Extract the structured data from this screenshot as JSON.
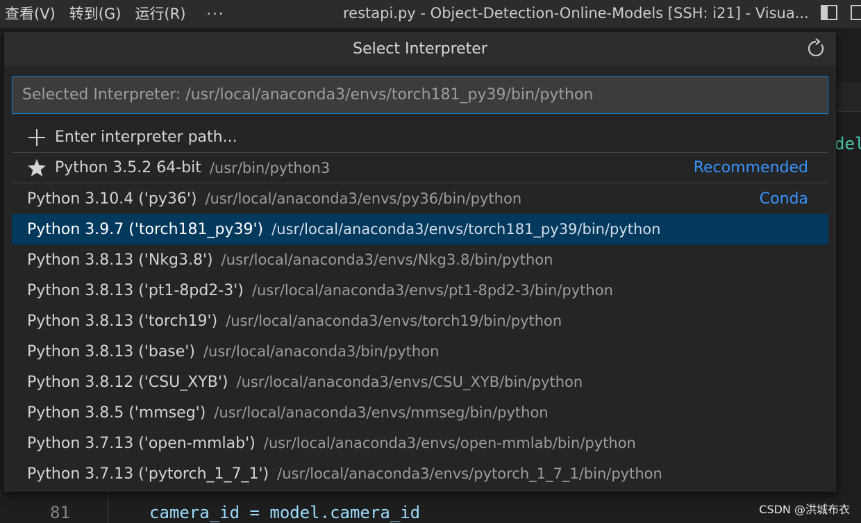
{
  "titlebar": {
    "menus": [
      "查看(V)",
      "转到(G)",
      "运行(R)"
    ],
    "more": "···",
    "window_title": "restapi.py - Object-Detection-Online-Models [SSH: i21] - Visua..."
  },
  "quickpick": {
    "title": "Select Interpreter",
    "input_placeholder": "Selected Interpreter: /usr/local/anaconda3/envs/torch181_py39/bin/python",
    "enter_path": "Enter interpreter path...",
    "items": [
      {
        "label": "Python 3.5.2 64-bit",
        "path": "/usr/bin/python3",
        "tag": "Recommended",
        "icon": "star-icon"
      },
      {
        "label": "Python 3.10.4 ('py36')",
        "path": "/usr/local/anaconda3/envs/py36/bin/python",
        "tag": "Conda"
      },
      {
        "label": "Python 3.9.7 ('torch181_py39')",
        "path": "/usr/local/anaconda3/envs/torch181_py39/bin/python",
        "selected": true
      },
      {
        "label": "Python 3.8.13 ('Nkg3.8')",
        "path": "/usr/local/anaconda3/envs/Nkg3.8/bin/python"
      },
      {
        "label": "Python 3.8.13 ('pt1-8pd2-3')",
        "path": "/usr/local/anaconda3/envs/pt1-8pd2-3/bin/python"
      },
      {
        "label": "Python 3.8.13 ('torch19')",
        "path": "/usr/local/anaconda3/envs/torch19/bin/python"
      },
      {
        "label": "Python 3.8.13 ('base')",
        "path": "/usr/local/anaconda3/bin/python"
      },
      {
        "label": "Python 3.8.12 ('CSU_XYB')",
        "path": "/usr/local/anaconda3/envs/CSU_XYB/bin/python"
      },
      {
        "label": "Python 3.8.5 ('mmseg')",
        "path": "/usr/local/anaconda3/envs/mmseg/bin/python"
      },
      {
        "label": "Python 3.7.13 ('open-mmlab')",
        "path": "/usr/local/anaconda3/envs/open-mmlab/bin/python"
      },
      {
        "label": "Python 3.7.13 ('pytorch_1_7_1')",
        "path": "/usr/local/anaconda3/envs/pytorch_1_7_1/bin/python"
      }
    ]
  },
  "editor": {
    "line_number": "81",
    "code_line": "camera_id = model.camera_id",
    "edge_fragment": "del"
  },
  "watermark": "CSDN @洪城布衣",
  "colors": {
    "accent": "#0e7fd4",
    "selection": "#04395e",
    "tag": "#3794ff"
  }
}
